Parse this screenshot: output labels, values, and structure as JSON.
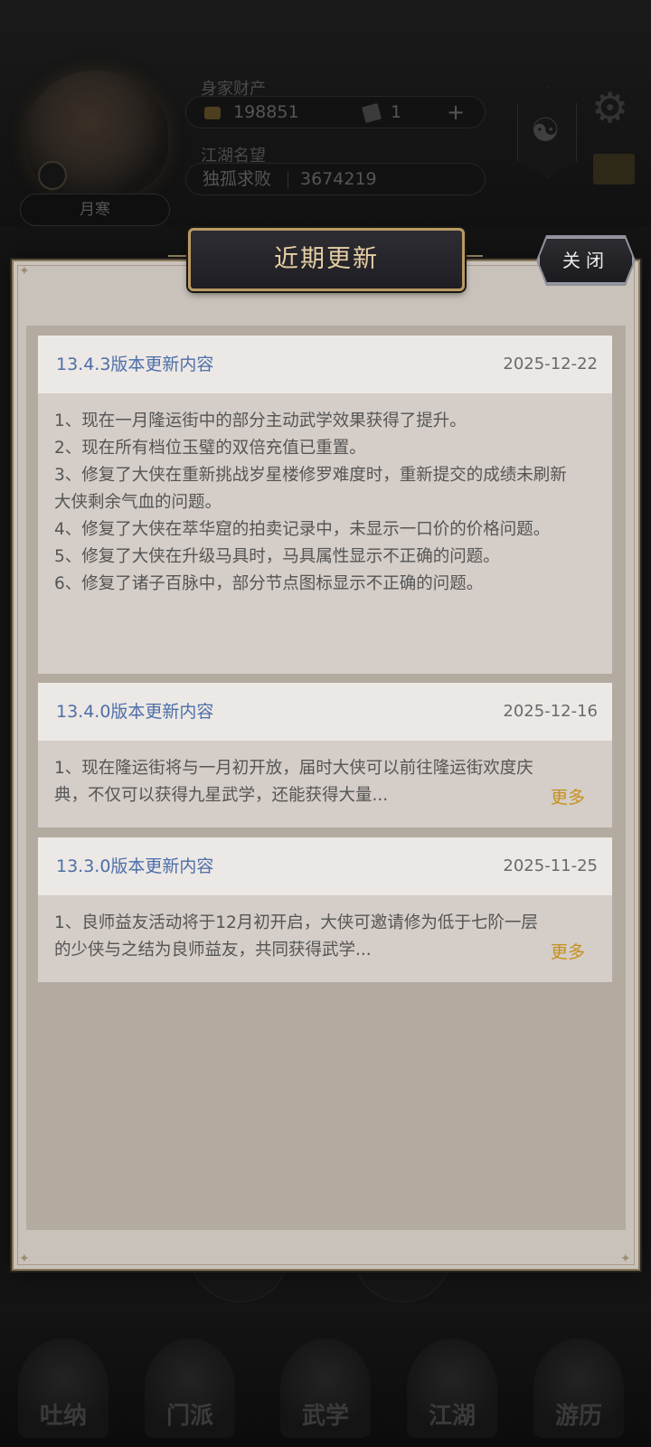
{
  "background": {
    "player_name": "月寒",
    "stat1_label": "身家财产",
    "coins": "198851",
    "tickets": "1",
    "plus_symbol": "+",
    "stat2_label": "江湖名望",
    "rank_title": "独孤求败",
    "reputation": "3674219",
    "nav_items": [
      "吐纳",
      "门派",
      "武学",
      "江湖",
      "游历"
    ]
  },
  "dialog": {
    "title": "近期更新",
    "close_label": "关闭"
  },
  "updates": [
    {
      "title": "13.4.3版本更新内容",
      "date": "2025-12-22",
      "text": "1、现在一月隆运街中的部分主动武学效果获得了提升。\n2、现在所有档位玉璧的双倍充值已重置。\n3、修复了大侠在重新挑战岁星楼修罗难度时，重新提交的成绩未刷新大侠剩余气血的问题。\n4、修复了大侠在萃华窟的拍卖记录中，未显示一口价的价格问题。\n5、修复了大侠在升级马具时，马具属性显示不正确的问题。\n6、修复了诸子百脉中，部分节点图标显示不正确的问题。"
    },
    {
      "title": "13.4.0版本更新内容",
      "date": "2025-12-16",
      "text": "1、现在隆运街将与一月初开放，届时大侠可以前往隆运街欢度庆典，不仅可以获得九星武学，还能获得大量...",
      "more_label": "更多"
    },
    {
      "title": "13.3.0版本更新内容",
      "date": "2025-11-25",
      "text": "1、良师益友活动将于12月初开启，大侠可邀请修为低于七阶一层的少侠与之结为良师益友，共同获得武学...",
      "more_label": "更多"
    }
  ],
  "colors": {
    "accent_gold": "#c7901b",
    "entry_title_blue": "#4d6fa8",
    "dialog_bg": "#c9c2ba",
    "title_plate_bg": "#1f1e24",
    "title_text": "#e6cfa3"
  },
  "icons": [
    "coin-icon",
    "ticket-icon",
    "yinyang-icon",
    "gear-icon",
    "mail-icon",
    "close-icon"
  ]
}
